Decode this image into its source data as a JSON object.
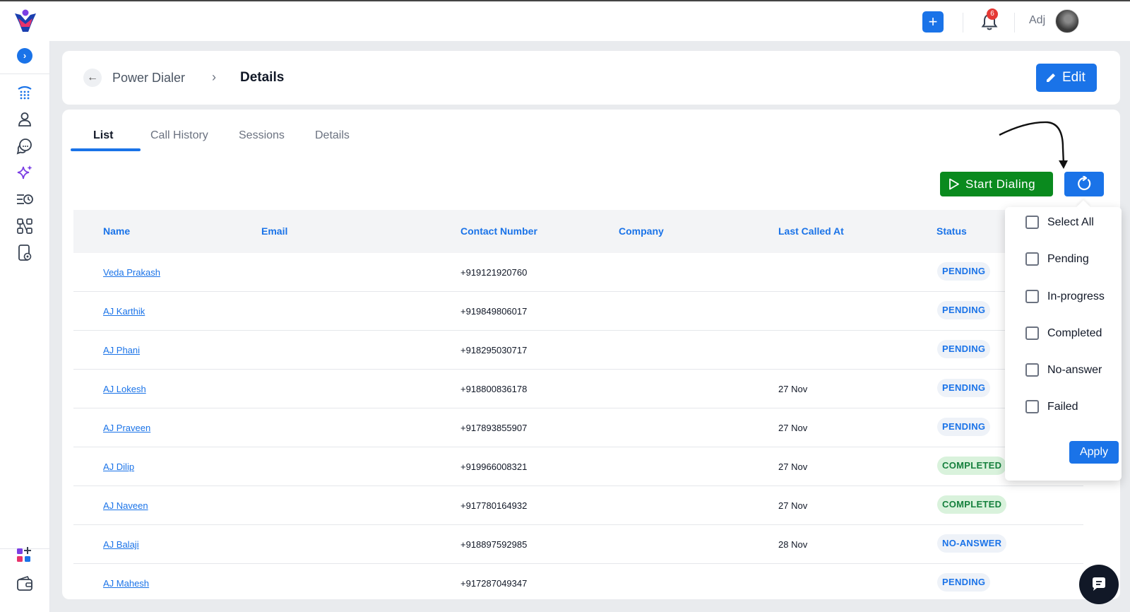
{
  "topbar": {
    "user_name": "Adj",
    "notification_count": "6"
  },
  "breadcrumb": {
    "parent": "Power Dialer",
    "current": "Details"
  },
  "header": {
    "edit_label": "Edit"
  },
  "tabs": [
    "List",
    "Call History",
    "Sessions",
    "Details"
  ],
  "actions": {
    "start_label": "Start Dialing"
  },
  "table": {
    "columns": [
      "Name",
      "Email",
      "Contact Number",
      "Company",
      "Last Called At",
      "Status"
    ],
    "rows": [
      {
        "name": "Veda Prakash",
        "phone": "+919121920760",
        "last_called": "",
        "status": "PENDING",
        "status_type": "pending"
      },
      {
        "name": "AJ Karthik",
        "phone": "+919849806017",
        "last_called": "",
        "status": "PENDING",
        "status_type": "pending"
      },
      {
        "name": "AJ Phani",
        "phone": "+918295030717",
        "last_called": "",
        "status": "PENDING",
        "status_type": "pending"
      },
      {
        "name": "AJ Lokesh",
        "phone": "+918800836178",
        "last_called": "27 Nov",
        "status": "PENDING",
        "status_type": "pending"
      },
      {
        "name": "AJ Praveen",
        "phone": "+917893855907",
        "last_called": "27 Nov",
        "status": "PENDING",
        "status_type": "pending"
      },
      {
        "name": "AJ Dilip",
        "phone": "+919966008321",
        "last_called": "27 Nov",
        "status": "COMPLETED",
        "status_type": "completed"
      },
      {
        "name": "AJ Naveen",
        "phone": "+917780164932",
        "last_called": "27 Nov",
        "status": "COMPLETED",
        "status_type": "completed"
      },
      {
        "name": "AJ Balaji",
        "phone": "+918897592985",
        "last_called": "28 Nov",
        "status": "NO-ANSWER",
        "status_type": "noanswer"
      },
      {
        "name": "AJ Mahesh",
        "phone": "+917287049347",
        "last_called": "",
        "status": "PENDING",
        "status_type": "pending"
      }
    ]
  },
  "filter_dropdown": {
    "options": [
      "Select All",
      "Pending",
      "In-progress",
      "Completed",
      "No-answer",
      "Failed"
    ],
    "apply_label": "Apply"
  },
  "colors": {
    "primary": "#1a73e8",
    "start_green": "#0a8a1e",
    "completed_bg": "#d9f2dc",
    "completed_text": "#15803d",
    "notification_badge": "#e53935"
  },
  "icons": {
    "sidebar": [
      "phone-dialpad-icon",
      "contacts-icon",
      "chat-icon",
      "ai-sparkle-icon",
      "queue-history-icon",
      "workflow-icon",
      "device-settings-icon",
      "apps-add-icon",
      "wallet-icon"
    ]
  }
}
